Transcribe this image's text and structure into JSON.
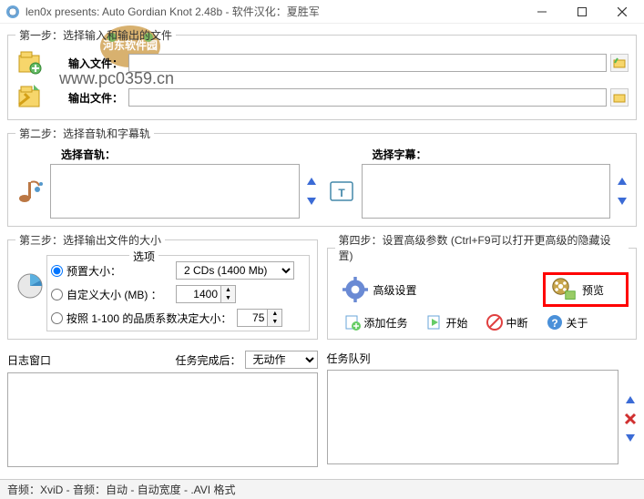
{
  "window": {
    "title": "len0x presents: Auto Gordian Knot 2.48b - 软件汉化：夏胜军"
  },
  "watermark": {
    "url": "www.pc0359.cn",
    "logo_text": "河东软件园"
  },
  "step1": {
    "legend": "第一步：选择输入和输出的文件",
    "input_label": "输入文件：",
    "output_label": "输出文件：",
    "input_value": "",
    "output_value": ""
  },
  "step2": {
    "legend": "第二步：选择音轨和字幕轨",
    "audio_label": "选择音轨：",
    "subtitle_label": "选择字幕："
  },
  "step3": {
    "legend": "第三步：选择输出文件的大小",
    "options_label": "选项",
    "preset_label": "预置大小：",
    "preset_value": "2 CDs (1400 Mb)",
    "custom_label": "自定义大小 (MB) ：",
    "custom_value": "1400",
    "quality_label": "按照 1-100 的品质系数决定大小：",
    "quality_value": "75"
  },
  "step4": {
    "legend": "第四步：设置高级参数 (Ctrl+F9可以打开更高级的隐藏设置)",
    "adv_settings": "高级设置",
    "preview": "预览"
  },
  "toolbar": {
    "add_task": "添加任务",
    "start": "开始",
    "stop": "中断",
    "about": "关于"
  },
  "log": {
    "log_label": "日志窗口",
    "after_label": "任务完成后：",
    "after_value": "无动作",
    "queue_label": "任务队列"
  },
  "status": {
    "text": "音频：XviD - 音频：自动 - 自动宽度 - .AVI 格式"
  }
}
